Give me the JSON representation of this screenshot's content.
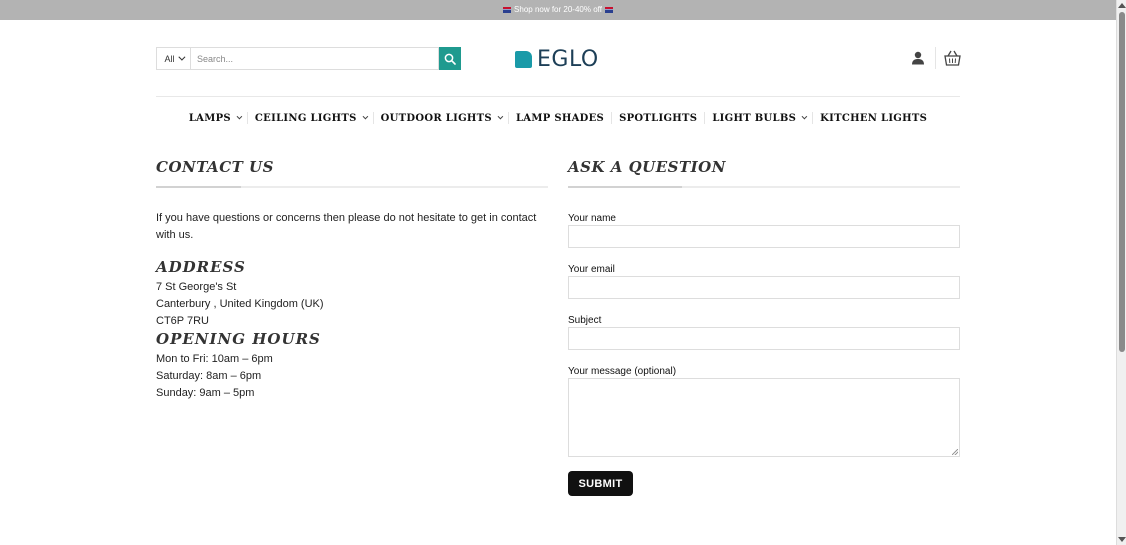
{
  "promo": {
    "text": "Shop now for 20-40% off"
  },
  "search": {
    "category": "All",
    "placeholder": "Search..."
  },
  "logo": {
    "text": "EGLO"
  },
  "nav": [
    {
      "label": "LAMPS",
      "dropdown": true
    },
    {
      "label": "CEILING LIGHTS",
      "dropdown": true
    },
    {
      "label": "OUTDOOR LIGHTS",
      "dropdown": true
    },
    {
      "label": "LAMP SHADES",
      "dropdown": false
    },
    {
      "label": "SPOTLIGHTS",
      "dropdown": false
    },
    {
      "label": "LIGHT BULBS",
      "dropdown": true
    },
    {
      "label": "KITCHEN LIGHTS",
      "dropdown": false
    }
  ],
  "contact": {
    "title": "CONTACT US",
    "intro": "If you have questions or concerns then please do not hesitate to get in contact with us.",
    "address_title": "ADDRESS",
    "address": [
      "7 St George's St",
      "Canterbury , United Kingdom (UK)",
      "CT6P 7RU"
    ],
    "hours_title": "OPENING HOURS",
    "hours": [
      "Mon to Fri: 10am – 6pm",
      "Saturday: 8am – 6pm",
      "Sunday: 9am – 5pm"
    ]
  },
  "form": {
    "title": "ASK A QUESTION",
    "name_label": "Your name",
    "email_label": "Your email",
    "subject_label": "Subject",
    "message_label": "Your message (optional)",
    "submit_label": "SUBMIT"
  },
  "colors": {
    "accent": "#1f9a8f",
    "logo_mark": "#1a9aa8",
    "logo_text": "#1d3f57",
    "promo_bar": "#b3b3b3"
  },
  "icons": [
    "flag-icon",
    "search-icon",
    "chevron-down-icon",
    "user-icon",
    "cart-icon"
  ]
}
